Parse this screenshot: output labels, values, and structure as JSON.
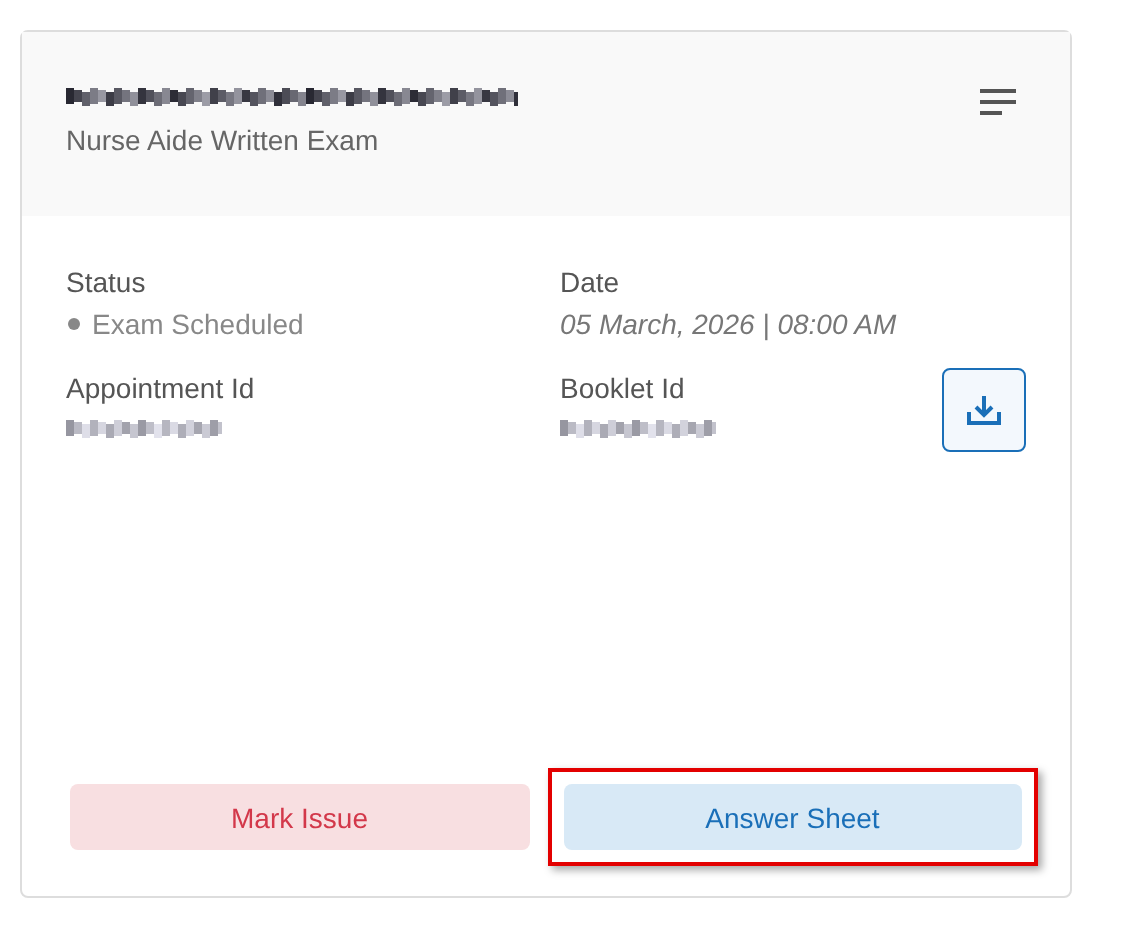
{
  "card": {
    "title_redacted": true,
    "subtitle": "Nurse Aide Written Exam",
    "fields": [
      {
        "label": "Status",
        "value": "Exam Scheduled",
        "kind": "status"
      },
      {
        "label": "Date",
        "value": "05 March, 2026 | 08:00 AM",
        "kind": "date"
      },
      {
        "label": "Appointment Id",
        "kind": "redacted"
      },
      {
        "label": "Booklet Id",
        "kind": "redacted",
        "download": true
      }
    ],
    "buttons": [
      {
        "label": "Mark Issue",
        "kind": "danger",
        "highlighted": false
      },
      {
        "label": "Answer Sheet",
        "kind": "primary",
        "highlighted": true
      }
    ]
  }
}
